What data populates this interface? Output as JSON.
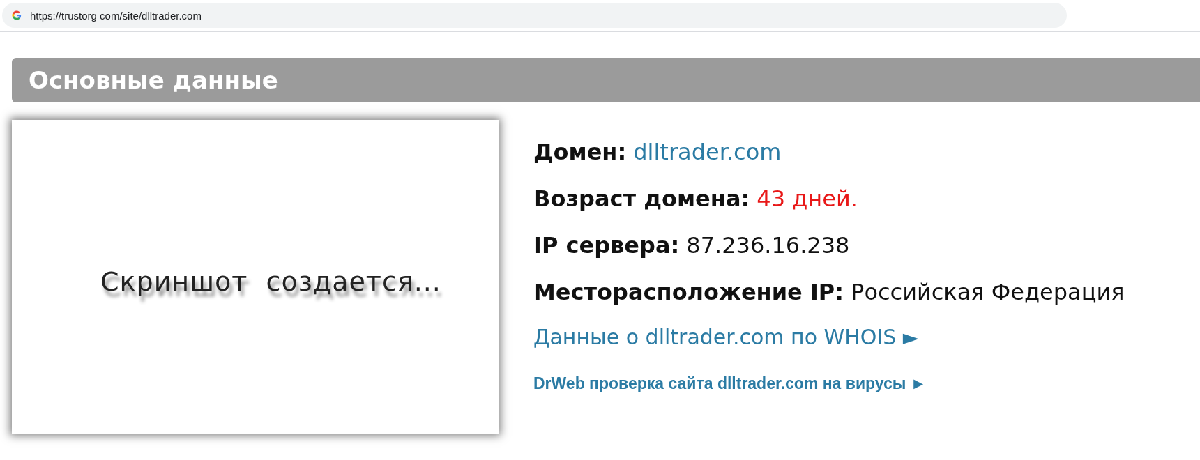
{
  "address_bar": {
    "url": "https://trustorg com/site/dlltrader.com"
  },
  "section": {
    "title": "Основные данные"
  },
  "screenshot_preview": {
    "caption": "Скриншот  создается..."
  },
  "info": [
    {
      "label": "Домен:",
      "value": "dlltrader.com",
      "kind": "link"
    },
    {
      "label": "Возраст домена:",
      "value": "43 дней.",
      "kind": "alert"
    },
    {
      "label": "IP сервера:",
      "value": "87.236.16.238",
      "kind": "plain"
    },
    {
      "label": "Месторасположение IP:",
      "value": "Российская Федерация",
      "kind": "plain"
    }
  ],
  "links": [
    {
      "text": "Данные о dlltrader.com по WHOIS ►",
      "kind": "large"
    },
    {
      "text": "DrWeb проверка сайта dlltrader.com на вирусы ►",
      "kind": "bold"
    }
  ]
}
